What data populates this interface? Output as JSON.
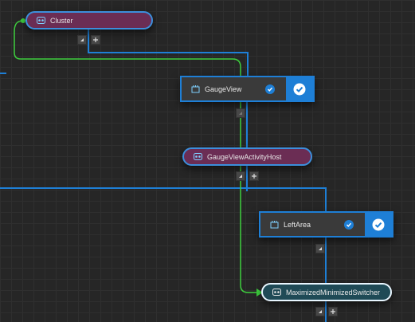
{
  "nodes": {
    "cluster": {
      "label": "Cluster",
      "icon": "view-group-icon"
    },
    "gauge_view": {
      "label": "GaugeView",
      "icon": "view-icon",
      "checked": true
    },
    "gauge_view_activity_host": {
      "label": "GaugeViewActivityHost",
      "icon": "view-group-icon"
    },
    "left_area": {
      "label": "LeftArea",
      "icon": "view-icon",
      "checked": true
    },
    "maximized_minimized_switcher": {
      "label": "MaximizedMinimizedSwitcher",
      "icon": "view-group-icon",
      "selected": true
    }
  },
  "colors": {
    "canvas": "#262626",
    "grid": "#2f2f2f",
    "hierarchy_wire": "#1e7fd6",
    "binding_wire": "#3ecf3e",
    "group_node": "#6b2d54",
    "selected_node": "#1f4a56",
    "card_node": "#3a3a3a"
  },
  "controls": {
    "collapse_icon": "collapse-triangle-icon",
    "expand_icon": "plus-icon"
  }
}
